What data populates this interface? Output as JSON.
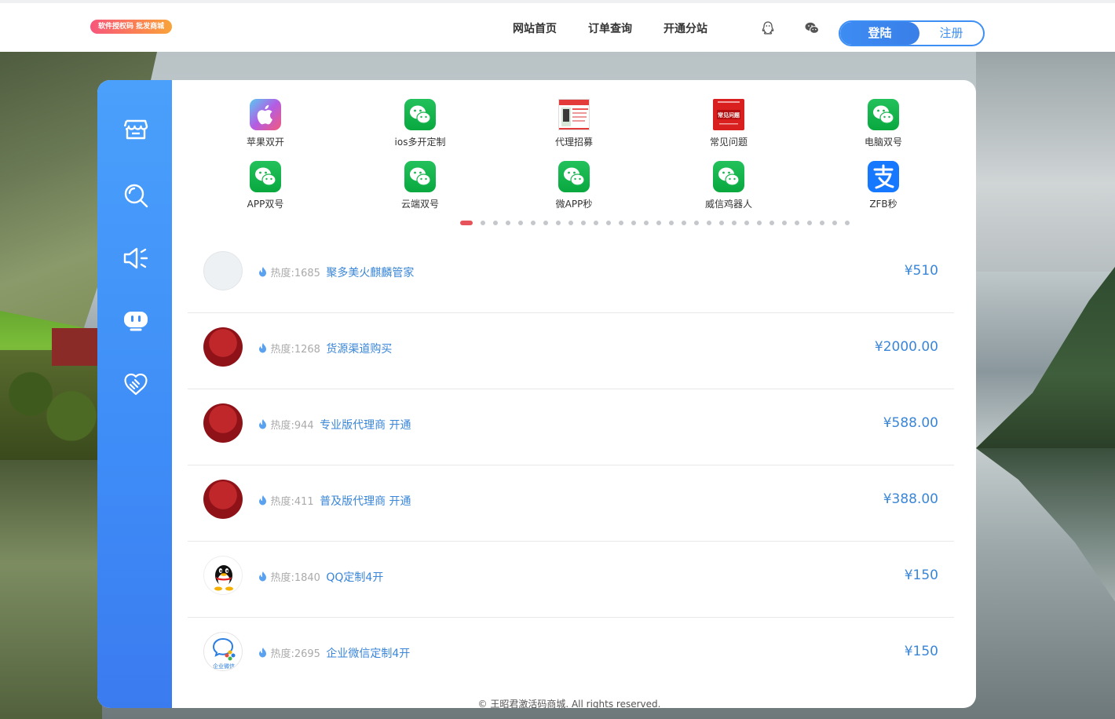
{
  "header": {
    "logo_text": "软件授权码 批发商城",
    "nav": [
      "网站首页",
      "订单查询",
      "开通分站"
    ],
    "icons": [
      "qq-icon",
      "wechat-icon"
    ],
    "login_label": "登陆",
    "register_label": "注册"
  },
  "sidebar": {
    "icons": [
      "store-icon",
      "search-icon",
      "announcement-icon",
      "robot-icon",
      "handshake-icon"
    ]
  },
  "apps": [
    {
      "label": "苹果双开",
      "icon": "apple-icon"
    },
    {
      "label": "ios多开定制",
      "icon": "wechat-icon"
    },
    {
      "label": "代理招募",
      "icon": "poster-icon"
    },
    {
      "label": "常见问题",
      "icon": "faq-poster-icon",
      "image_text": "常见问题"
    },
    {
      "label": "电脑双号",
      "icon": "wechat-icon"
    },
    {
      "label": "APP双号",
      "icon": "wechat-icon"
    },
    {
      "label": "云端双号",
      "icon": "wechat-icon"
    },
    {
      "label": "微APP秒",
      "icon": "wechat-icon"
    },
    {
      "label": "威信鸡器人",
      "icon": "wechat-icon"
    },
    {
      "label": "ZFB秒",
      "icon": "alipay-icon"
    }
  ],
  "carousel": {
    "total_pages": 31,
    "active_index": 0
  },
  "products": [
    {
      "heat_label": "热度:1685",
      "name": "聚多美火麒麟管家",
      "price": "¥510",
      "avatar": "grey"
    },
    {
      "heat_label": "热度:1268",
      "name": "货源渠道购买",
      "price": "¥2000.00",
      "avatar": "red"
    },
    {
      "heat_label": "热度:944",
      "name": "专业版代理商 开通",
      "price": "¥588.00",
      "avatar": "red"
    },
    {
      "heat_label": "热度:411",
      "name": "普及版代理商 开通",
      "price": "¥388.00",
      "avatar": "red"
    },
    {
      "heat_label": "热度:1840",
      "name": "QQ定制4开",
      "price": "¥150",
      "avatar": "qq"
    },
    {
      "heat_label": "热度:2695",
      "name": "企业微信定制4开",
      "price": "¥150",
      "avatar": "wework",
      "avatar_text": "企业微信"
    }
  ],
  "footer": "© 王昭君激活码商城. All rights reserved.",
  "colors": {
    "accent": "#3d8ff5",
    "price": "#3a86d8",
    "sidebar": "#4196f8",
    "dot_active": "#e6535a"
  }
}
